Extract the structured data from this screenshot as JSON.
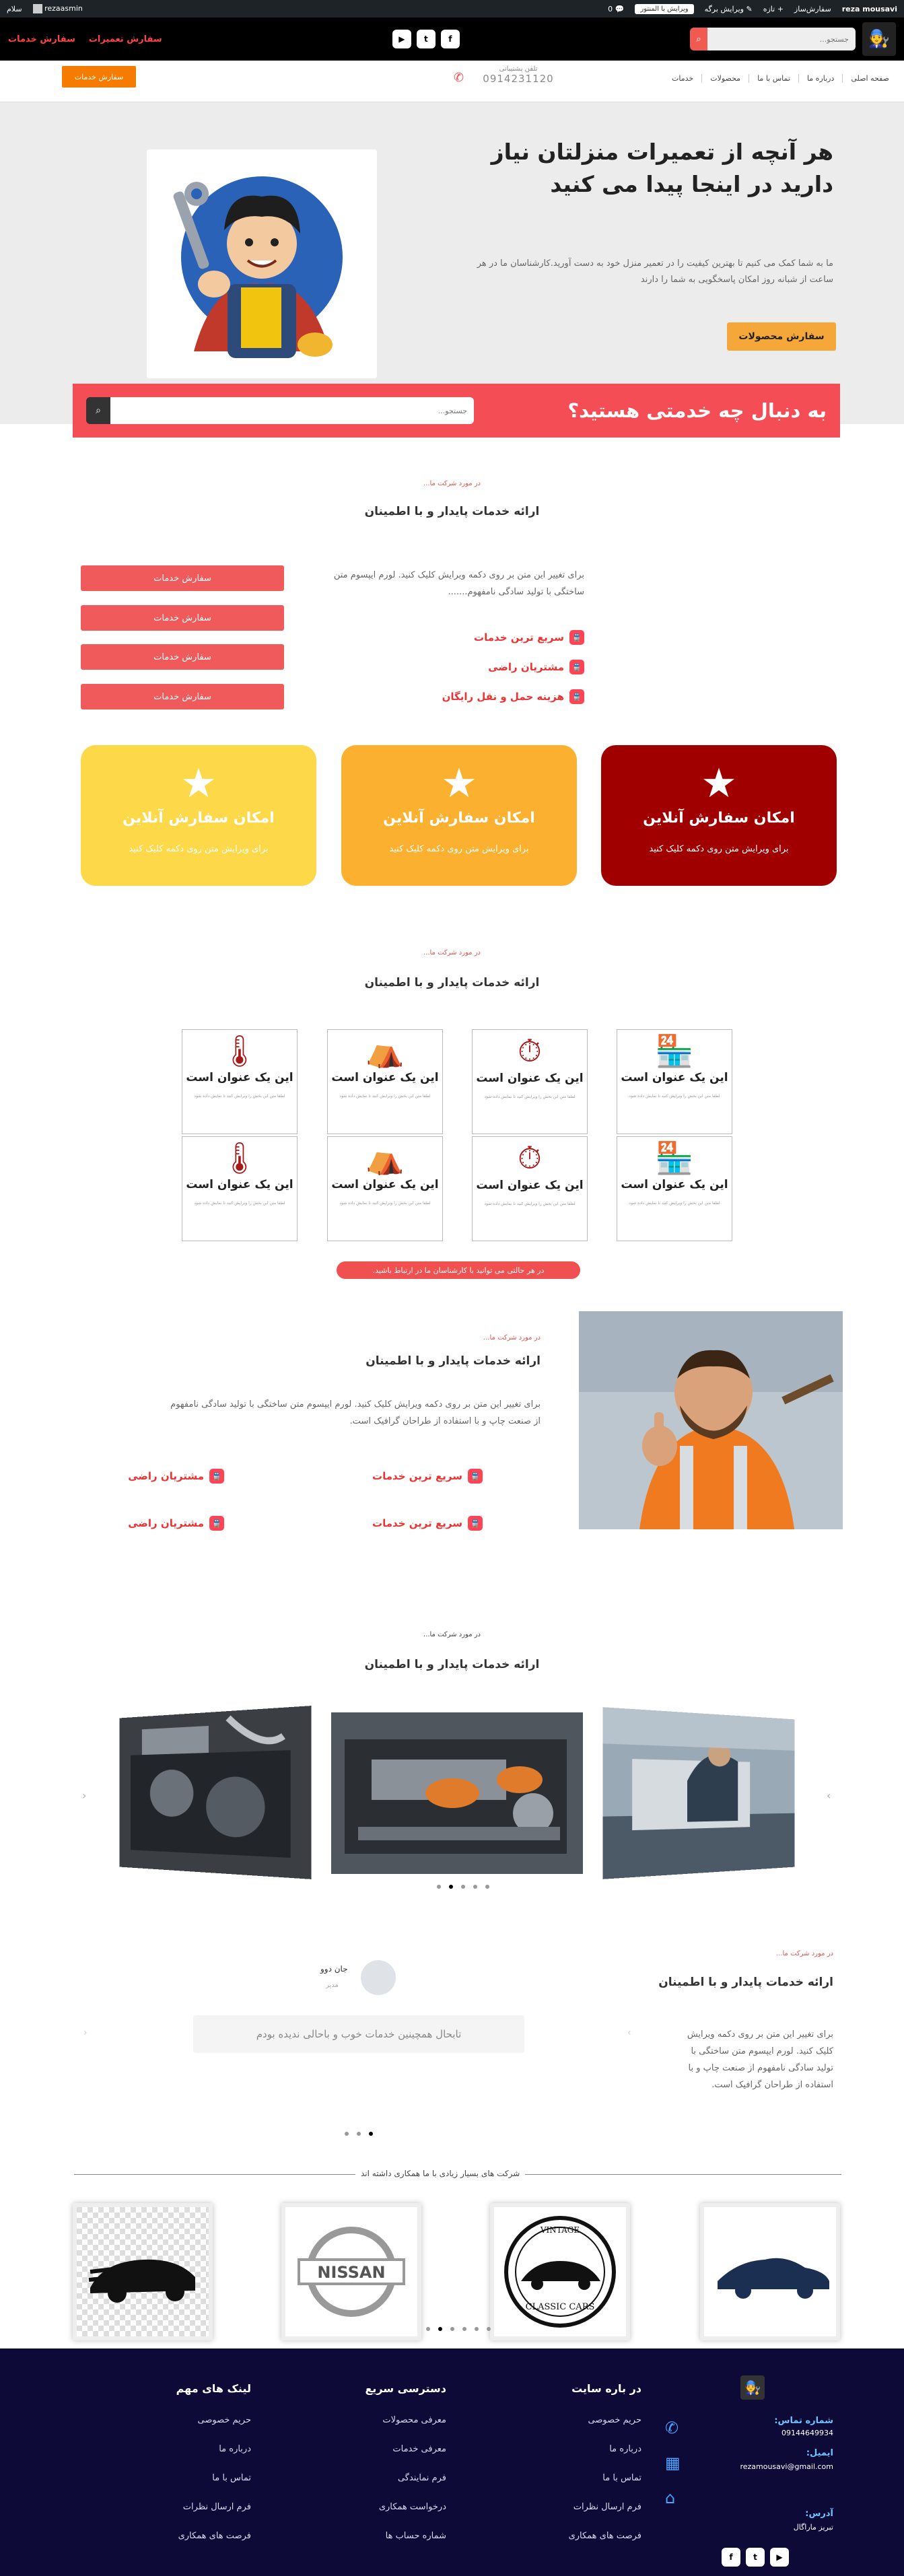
{
  "adminbar": {
    "user": "reza mousavi",
    "site": "سفارش‌ساز",
    "add_new": "تازه",
    "edit_page": "ویرایش برگه",
    "elementor": "ویرایش با المنتور",
    "comments_count": "0",
    "hello": "سلام",
    "username": "rezaasmin"
  },
  "header": {
    "search_placeholder": "جستجو...",
    "order_services": "سفارش خدمات",
    "order_repairs": "سفارش تعمیرات",
    "social": [
      "f",
      "t",
      "▶"
    ]
  },
  "nav": {
    "menu": [
      "صفحه اصلی",
      "درباره ما",
      "تماس با ما",
      "محصولات",
      "خدمات"
    ],
    "phone_label": "تلفن پشتیبانی",
    "phone": "0914231120",
    "order_button": "سفارش خدمات"
  },
  "hero": {
    "title": "هر آنچه از تعمیرات منزلتان نیاز دارید در اینجا پیدا می کنید",
    "description": "ما به شما کمک می کنیم تا بهترین کیفیت را در تعمیر منزل خود به دست آورید.کارشناسان ما در هر ساعت از شبانه روز امکان پاسخگویی به شما را دارند",
    "cta": "سفارش محصولات"
  },
  "banner": {
    "title": "به دنبال چه خدمتی هستید؟",
    "search_placeholder": "جستجو..."
  },
  "section1": {
    "kicker": "در مورد شرکت ما...",
    "heading": "ارائه خدمات پایدار و با اطمینان",
    "text": "برای تغییر این متن بر روی دکمه ویرایش کلیک کنید. لورم ایپسوم متن ساختگی با تولید سادگی نامفهوم.......",
    "features": [
      "سریع ترین خدمات",
      "مشتریان راضی",
      "هزینه حمل و نقل رایگان"
    ],
    "buttons": [
      "سفارش خدمات",
      "سفارش خدمات",
      "سفارش خدمات",
      "سفارش خدمات"
    ]
  },
  "cards": [
    {
      "title": "امکان سفارش آنلاین",
      "sub": "برای ویرایش متن روی دکمه کلیک کنید",
      "color": "#a10000"
    },
    {
      "title": "امکان سفارش آنلاین",
      "sub": "برای ویرایش متن روی دکمه کلیک کنید",
      "color": "#fbb12f"
    },
    {
      "title": "امکان سفارش آنلاین",
      "sub": "برای ویرایش متن روی دکمه کلیک کنید",
      "color": "#fdd94a"
    }
  ],
  "section2": {
    "kicker": "در مورد شرکت ما...",
    "heading": "ارائه خدمات پایدار و با اطمینان",
    "tiles": [
      {
        "icon": "shop-icon",
        "title": "این یک عنوان است"
      },
      {
        "icon": "stopwatch-icon",
        "title": "این یک عنوان است"
      },
      {
        "icon": "store-icon",
        "title": "این یک عنوان است"
      },
      {
        "icon": "thermometer-icon",
        "title": "این یک عنوان است"
      },
      {
        "icon": "shop-icon",
        "title": "این یک عنوان است"
      },
      {
        "icon": "stopwatch-icon",
        "title": "این یک عنوان است"
      },
      {
        "icon": "store-icon",
        "title": "این یک عنوان است"
      },
      {
        "icon": "thermometer-icon",
        "title": "این یک عنوان است"
      }
    ],
    "tile_sub": "لطفا متن این بخش را ویرایش کنید تا نمایش داده شود",
    "pill": "در هر حالتی می توانید با کارشناسان ما در ارتباط باشید."
  },
  "section3": {
    "kicker": "در مورد شرکت ما...",
    "heading": "ارائه خدمات پایدار و با اطمینان",
    "text": "برای تغییر این متن بر روی دکمه ویرایش کلیک کنید. لورم ایپسوم متن ساختگی با تولید سادگی نامفهوم از صنعت چاپ و با استفاده از طراحان گرافیک است.",
    "features": [
      "سریع ترین خدمات",
      "مشتریان راضی",
      "سریع ترین خدمات",
      "مشتریان راضی"
    ]
  },
  "section4": {
    "kicker": "در مورد شرکت ما...",
    "heading": "ارائه خدمات پایدار و با اطمینان"
  },
  "section5": {
    "kicker": "در مورد شرکت ما...",
    "heading": "ارائه خدمات پایدار و با اطمینان",
    "text": "برای تغییر این متن بر روی دکمه ویرایش کلیک کنید. لورم ایپسوم متن ساختگی با تولید سادگی نامفهوم از صنعت چاپ و با استفاده از طراحان گرافیک است.",
    "testimonial_name": "جان دوو",
    "testimonial_role": "مدیر",
    "testimonial_quote": "تابحال همچینین خدمات خوب و باحالی ندیده بودم"
  },
  "brands": {
    "caption": "شرکت های بسیار زیادی با ما همکاری داشته اند",
    "items": [
      "NISSAN",
      "VINTAGE CLASSIC CARS"
    ]
  },
  "footer": {
    "contact_phone_label": "شماره تماس:",
    "contact_phone": "09144649934",
    "email_label": "ایمیل:",
    "email": "rezamousavi@gmail.com",
    "address_label": "آدرس:",
    "address": "تبریز ماراگال",
    "about_title": "در باره سایت",
    "about_items": [
      "حریم خصوصی",
      "درباره ما",
      "تماس با ما",
      "فرم ارسال نظرات",
      "فرصت های همکاری"
    ],
    "quick_title": "دسترسی سریع",
    "quick_items": [
      "معرفی محصولات",
      "معرفی خدمات",
      "فرم نمایندگی",
      "درخواست همکاری",
      "شماره حساب ها"
    ],
    "links_title": "لینک های مهم",
    "links_items": [
      "حریم خصوصی",
      "درباره ما",
      "تماس با ما",
      "فرم ارسال نظرات",
      "فرصت های همکاری"
    ]
  }
}
